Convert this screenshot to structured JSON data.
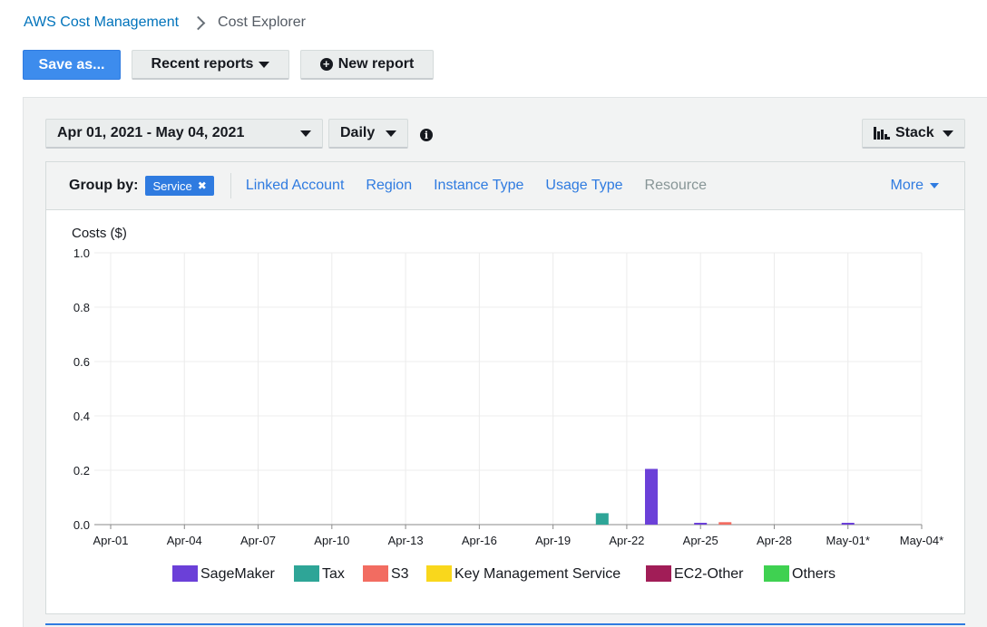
{
  "breadcrumb": {
    "parent": "AWS Cost Management",
    "current": "Cost Explorer"
  },
  "toolbar": {
    "save_label": "Save as...",
    "recent_label": "Recent reports",
    "new_label": "New report"
  },
  "controls": {
    "date_range": "Apr 01, 2021 - May 04, 2021",
    "granularity": "Daily",
    "chart_style": "Stack"
  },
  "group_by": {
    "label": "Group by:",
    "selected": "Service",
    "options": [
      {
        "label": "Linked Account",
        "enabled": true
      },
      {
        "label": "Region",
        "enabled": true
      },
      {
        "label": "Instance Type",
        "enabled": true
      },
      {
        "label": "Usage Type",
        "enabled": true
      },
      {
        "label": "Resource",
        "enabled": false
      }
    ],
    "more_label": "More"
  },
  "colors": {
    "primary": "#3d8ced",
    "link": "#2f7be0"
  },
  "chart_data": {
    "type": "bar",
    "stacked": true,
    "ylabel": "Costs ($)",
    "ylim": [
      0,
      1.0
    ],
    "yticks": [
      "0.0",
      "0.2",
      "0.4",
      "0.6",
      "0.8",
      "1.0"
    ],
    "x": [
      "Apr-01",
      "Apr-02",
      "Apr-03",
      "Apr-04",
      "Apr-05",
      "Apr-06",
      "Apr-07",
      "Apr-08",
      "Apr-09",
      "Apr-10",
      "Apr-11",
      "Apr-12",
      "Apr-13",
      "Apr-14",
      "Apr-15",
      "Apr-16",
      "Apr-17",
      "Apr-18",
      "Apr-19",
      "Apr-20",
      "Apr-21",
      "Apr-22",
      "Apr-23",
      "Apr-24",
      "Apr-25",
      "Apr-26",
      "Apr-27",
      "Apr-28",
      "Apr-29",
      "Apr-30",
      "May-01*",
      "May-02*",
      "May-03*",
      "May-04*"
    ],
    "xtick_labels": [
      "Apr-01",
      "Apr-04",
      "Apr-07",
      "Apr-10",
      "Apr-13",
      "Apr-16",
      "Apr-19",
      "Apr-22",
      "Apr-25",
      "Apr-28",
      "May-01*",
      "May-04*"
    ],
    "grid": true,
    "legend_position": "bottom",
    "series": [
      {
        "name": "SageMaker",
        "color": "#6b40d8",
        "values": [
          0,
          0,
          0,
          0,
          0,
          0,
          0,
          0,
          0,
          0,
          0,
          0,
          0,
          0,
          0,
          0,
          0,
          0,
          0,
          0,
          0,
          0,
          0.205,
          0,
          0.004,
          0,
          0,
          0,
          0,
          0,
          0.006,
          0,
          0,
          0
        ]
      },
      {
        "name": "Tax",
        "color": "#2ea597",
        "values": [
          0,
          0,
          0,
          0,
          0,
          0,
          0,
          0,
          0,
          0,
          0,
          0,
          0,
          0,
          0,
          0,
          0,
          0,
          0,
          0,
          0.042,
          0,
          0,
          0,
          0,
          0,
          0,
          0,
          0,
          0,
          0,
          0,
          0,
          0
        ]
      },
      {
        "name": "S3",
        "color": "#f26c61",
        "values": [
          0,
          0,
          0,
          0,
          0,
          0,
          0,
          0,
          0,
          0,
          0,
          0,
          0,
          0,
          0,
          0,
          0,
          0,
          0,
          0,
          0,
          0,
          0,
          0,
          0,
          0.009,
          0,
          0,
          0,
          0,
          0,
          0,
          0,
          0
        ]
      },
      {
        "name": "Key Management Service",
        "color": "#f9d71c",
        "values": [
          0,
          0,
          0,
          0,
          0,
          0,
          0,
          0,
          0,
          0,
          0,
          0,
          0,
          0,
          0,
          0,
          0,
          0,
          0,
          0,
          0,
          0,
          0,
          0,
          0,
          0,
          0,
          0,
          0,
          0,
          0,
          0,
          0,
          0
        ]
      },
      {
        "name": "EC2-Other",
        "color": "#a11d57",
        "values": [
          0,
          0,
          0,
          0,
          0,
          0,
          0,
          0,
          0,
          0,
          0,
          0,
          0,
          0,
          0,
          0,
          0,
          0,
          0,
          0,
          0,
          0,
          0,
          0,
          0,
          0,
          0,
          0,
          0,
          0,
          0,
          0,
          0,
          0
        ]
      },
      {
        "name": "Others",
        "color": "#3fd151",
        "values": [
          0,
          0,
          0,
          0,
          0,
          0,
          0,
          0,
          0,
          0,
          0,
          0,
          0,
          0,
          0,
          0,
          0,
          0,
          0,
          0,
          0,
          0,
          0,
          0,
          0,
          0,
          0,
          0,
          0,
          0,
          0,
          0,
          0,
          0
        ]
      }
    ]
  }
}
